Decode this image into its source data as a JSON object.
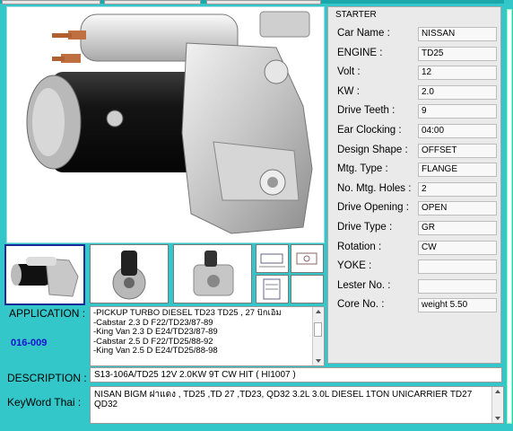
{
  "application": {
    "label": "APPLICATION :",
    "code": "016-009",
    "lines": [
      "-PICKUP TURBO DIESEL  TD23 TD25 , 27  บิ๊กเอ็ม",
      "-Cabstar 2.3 D F22/TD23/87-89",
      "-King Van 2.3 D E24/TD23/87-89",
      "-Cabstar 2.5 D F22/TD25/88-92",
      "-King Van 2.5 D E24/TD25/88-98"
    ]
  },
  "description": {
    "label": "DESCRIPTION :",
    "value": "S13-106A/TD25 12V 2.0KW 9T CW HIT ( HI1007 )"
  },
  "keyword": {
    "label": "KeyWord Thai :",
    "value": "NISAN BIGM ฝาแดง ,  TD25 ,TD 27 ,TD23, QD32 3.2L 3.0L DIESEL 1TON   UNICARRIER  TD27  QD32"
  },
  "panel": {
    "title": "STARTER",
    "rows": [
      {
        "label": "Car Name :",
        "value": "NISSAN"
      },
      {
        "label": "ENGINE :",
        "value": "TD25"
      },
      {
        "label": "Volt :",
        "value": "12"
      },
      {
        "label": "KW :",
        "value": "2.0"
      },
      {
        "label": "Drive Teeth :",
        "value": "9"
      },
      {
        "label": "Ear Clocking :",
        "value": "04:00"
      },
      {
        "label": "Design Shape :",
        "value": "OFFSET"
      },
      {
        "label": "Mtg. Type :",
        "value": "FLANGE"
      },
      {
        "label": "No. Mtg. Holes :",
        "value": "2"
      },
      {
        "label": "Drive Opening :",
        "value": "OPEN"
      },
      {
        "label": "Drive Type :",
        "value": "GR"
      },
      {
        "label": "Rotation :",
        "value": "CW"
      },
      {
        "label": "YOKE :",
        "value": ""
      },
      {
        "label": "Lester No. :",
        "value": ""
      },
      {
        "label": "Core No. :",
        "value": "weight  5.50"
      }
    ]
  },
  "colors": {
    "background": "#33c7c9",
    "code_text": "#1212d0",
    "panel_bg": "#eaeaea"
  },
  "icons": {
    "main_photo": "starter-motor-photo",
    "thumbnails": [
      "starter-side-thumb",
      "starter-front-thumb",
      "starter-rear-thumb",
      "diagram-thumb",
      "diagram-thumb",
      "diagram-thumb",
      "blank-thumb"
    ]
  }
}
